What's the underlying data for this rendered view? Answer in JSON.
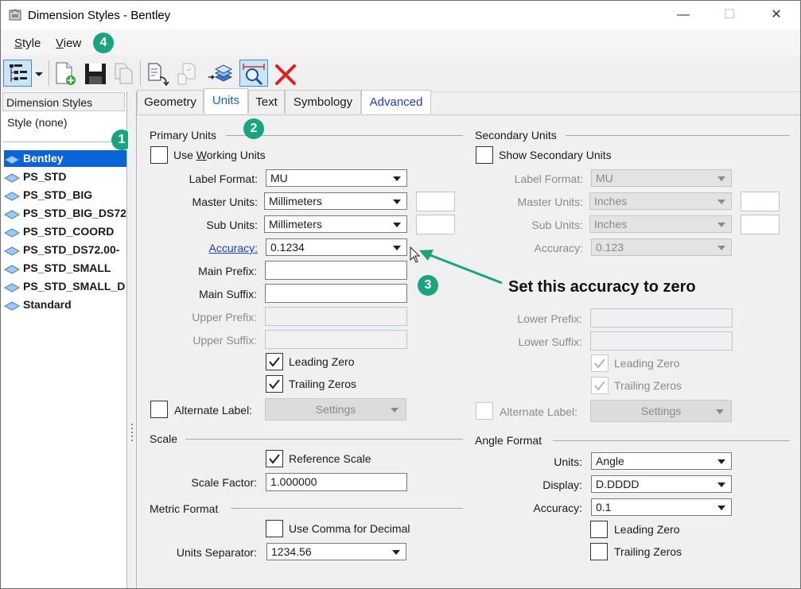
{
  "window": {
    "title": "Dimension Styles -  Bentley",
    "minimize": "—",
    "maximize": "☐",
    "close": "✕"
  },
  "menu": {
    "style_first": "S",
    "style_rest": "tyle",
    "view_first": "V",
    "view_rest": "iew"
  },
  "left_panel": {
    "header": "Dimension Styles",
    "current_style": "Style (none)",
    "items": [
      {
        "label": "Bentley"
      },
      {
        "label": "PS_STD"
      },
      {
        "label": "PS_STD_BIG"
      },
      {
        "label": "PS_STD_BIG_DS72"
      },
      {
        "label": "PS_STD_COORD"
      },
      {
        "label": "PS_STD_DS72.00-"
      },
      {
        "label": "PS_STD_SMALL"
      },
      {
        "label": "PS_STD_SMALL_D"
      },
      {
        "label": "Standard"
      }
    ]
  },
  "tabs": [
    {
      "label": "Geometry"
    },
    {
      "label": "Units"
    },
    {
      "label": "Text"
    },
    {
      "label": "Symbology"
    },
    {
      "label": "Advanced"
    }
  ],
  "primary": {
    "title": "Primary Units",
    "use_working_units_a": "Use ",
    "use_working_units_u": "W",
    "use_working_units_b": "orking Units",
    "label_format_label": "Label Format:",
    "label_format_value": "MU",
    "master_units_label": "Master Units:",
    "master_units_value": "Millimeters",
    "sub_units_label": "Sub Units:",
    "sub_units_value": "Millimeters",
    "accuracy_label": "Accuracy:",
    "accuracy_value": "0.1234",
    "main_prefix_label": "Main Prefix:",
    "main_suffix_label": "Main Suffix:",
    "upper_prefix_label": "Upper Prefix:",
    "upper_suffix_label": "Upper Suffix:",
    "leading_zero": "Leading Zero",
    "trailing_zeros": "Trailing Zeros",
    "alternate_label": "Alternate Label:",
    "settings": "Settings"
  },
  "secondary": {
    "title": "Secondary Units",
    "show_secondary": "Show Secondary Units",
    "label_format_label": "Label Format:",
    "label_format_value": "MU",
    "master_units_label": "Master Units:",
    "master_units_value": "Inches",
    "sub_units_label": "Sub Units:",
    "sub_units_value": "Inches",
    "accuracy_label": "Accuracy:",
    "accuracy_value": "0.123",
    "lower_prefix_label": "Lower Prefix:",
    "lower_suffix_label": "Lower Suffix:",
    "leading_zero": "Leading Zero",
    "trailing_zeros": "Trailing Zeros",
    "alternate_label": "Alternate Label:",
    "settings": "Settings"
  },
  "scale": {
    "title": "Scale",
    "reference_scale": "Reference Scale",
    "scale_factor_label": "Scale Factor:",
    "scale_factor_value": "1.000000"
  },
  "metric": {
    "title": "Metric Format",
    "use_comma": "Use Comma for Decimal",
    "units_separator_label": "Units Separator:",
    "units_separator_value": "1234.56"
  },
  "angle": {
    "title": "Angle Format",
    "units_label": "Units:",
    "units_value": "Angle",
    "display_label": "Display:",
    "display_value": "D.DDDD",
    "accuracy_label": "Accuracy:",
    "accuracy_value": "0.1",
    "leading_zero": "Leading Zero",
    "trailing_zeros": "Trailing Zeros"
  },
  "annotations": {
    "badge1": "1",
    "badge2": "2",
    "badge3": "3",
    "badge4": "4",
    "note": "Set this accuracy to zero",
    "accent": "#1aa37f"
  }
}
